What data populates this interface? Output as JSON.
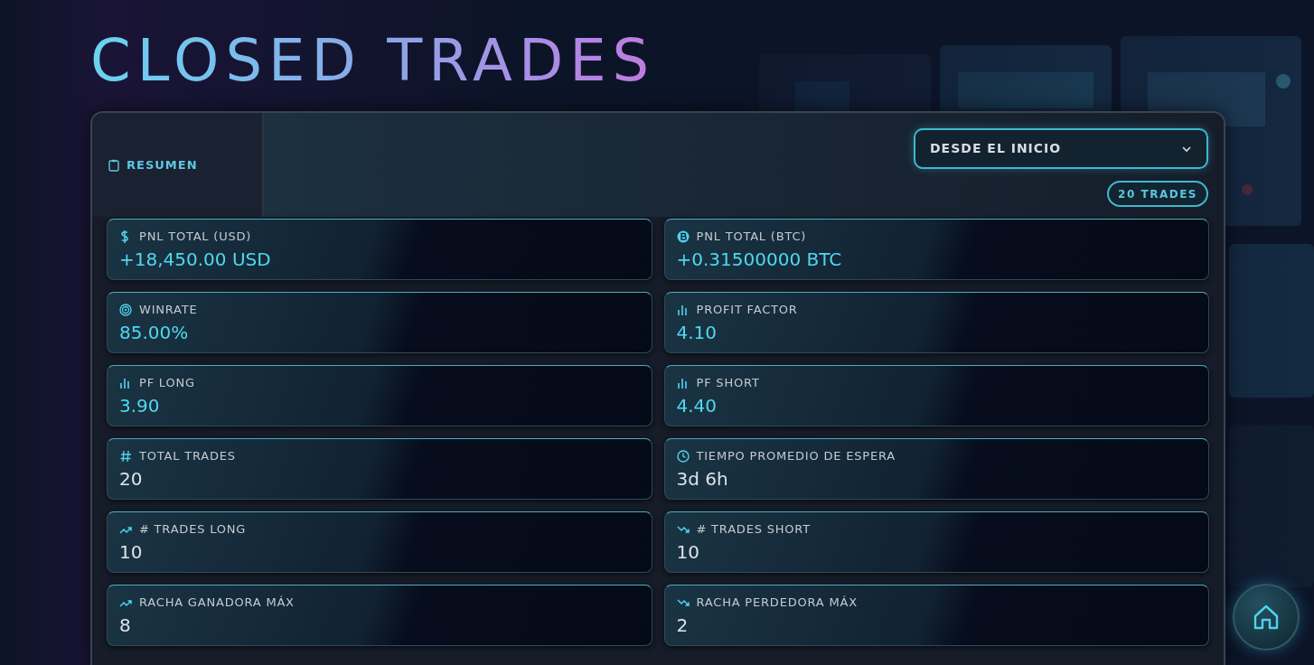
{
  "title": "CLOSED TRADES",
  "tabs": [
    {
      "label": "RESUMEN",
      "selected": true
    }
  ],
  "period_dropdown": {
    "value": "DESDE EL INICIO"
  },
  "trade_count_badge": "20 TRADES",
  "stats": [
    {
      "kind": "dollar",
      "label": "PNL TOTAL (USD)",
      "value": "+18,450.00 USD",
      "color": "#4fd8ee"
    },
    {
      "kind": "coin",
      "label": "PNL TOTAL (BTC)",
      "value": "+0.31500000 BTC",
      "color": "#4fd8ee"
    },
    {
      "kind": "target",
      "label": "WINRATE",
      "value": "85.00%",
      "color": "#4fd8ee"
    },
    {
      "kind": "bars",
      "label": "PROFIT FACTOR",
      "value": "4.10",
      "color": "#4fd8ee"
    },
    {
      "kind": "bars",
      "label": "PF LONG",
      "value": "3.90",
      "color": "#4fd8ee"
    },
    {
      "kind": "bars",
      "label": "PF SHORT",
      "value": "4.40",
      "color": "#4fd8ee"
    },
    {
      "kind": "hash",
      "label": "TOTAL TRADES",
      "value": "20",
      "color": "#dde2e8"
    },
    {
      "kind": "clock",
      "label": "TIEMPO PROMEDIO DE ESPERA",
      "value": "3d 6h",
      "color": "#dde2e8"
    },
    {
      "kind": "up",
      "label": "# TRADES LONG",
      "value": "10",
      "color": "#dde2e8"
    },
    {
      "kind": "down",
      "label": "# TRADES SHORT",
      "value": "10",
      "color": "#dde2e8"
    },
    {
      "kind": "up",
      "label": "RACHA GANADORA MÁX",
      "value": "8",
      "color": "#dde2e8"
    },
    {
      "kind": "down",
      "label": "RACHA PERDEDORA MÁX",
      "value": "2",
      "color": "#dde2e8"
    }
  ]
}
